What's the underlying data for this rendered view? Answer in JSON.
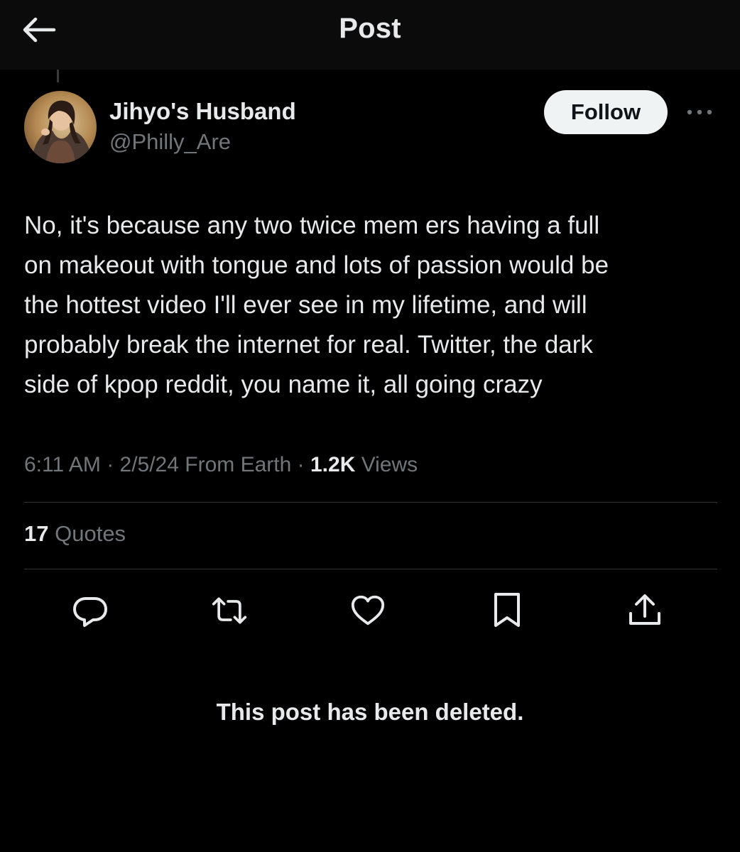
{
  "header": {
    "title": "Post",
    "back_icon": "arrow-left-icon"
  },
  "author": {
    "display_name": "Jihyo's Husband",
    "handle": "@Philly_Are",
    "follow_label": "Follow",
    "more_icon": "ellipsis-icon"
  },
  "post": {
    "text": "No, it's because any two twice mem ers having a full\non makeout with tongue and lots of passion would be\nthe hottest video I'll ever see in my lifetime, and will\nprobably break the internet for real.  Twitter, the dark\nside of kpop reddit, you name it, all going crazy",
    "time": "6:11 AM",
    "date": "2/5/24",
    "location": "From Earth",
    "views_count": "1.2K",
    "views_label": "Views"
  },
  "stats": {
    "quotes_count": "17",
    "quotes_label": "Quotes"
  },
  "actions": [
    {
      "name": "reply",
      "icon": "speech-bubble-icon"
    },
    {
      "name": "repost",
      "icon": "repost-icon"
    },
    {
      "name": "like",
      "icon": "heart-icon"
    },
    {
      "name": "bookmark",
      "icon": "bookmark-icon"
    },
    {
      "name": "share",
      "icon": "share-icon"
    }
  ],
  "notice": {
    "text": "This post has been deleted."
  },
  "colors": {
    "background": "#000000",
    "header_background": "#0b0b0b",
    "primary_text": "#e7e9ea",
    "secondary_text": "#71767b",
    "divider": "#2f3336",
    "follow_button_bg": "#eff3f4"
  }
}
